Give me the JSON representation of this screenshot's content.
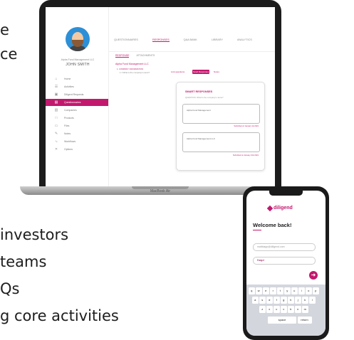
{
  "background_lines": [
    "e",
    "ce",
    "investors",
    "teams",
    "Qs",
    "g core activities"
  ],
  "laptop": {
    "brand": "MacBook Air",
    "sidebar": {
      "org_name": "Alpha Fund Management LLC",
      "user_name": "JOHN SMITH",
      "items": [
        {
          "label": "Home",
          "icon": "home-icon"
        },
        {
          "label": "Activities",
          "icon": "list-icon"
        },
        {
          "label": "Diligent Requests",
          "icon": "inbox-icon"
        },
        {
          "label": "Questionnaires",
          "icon": "document-icon"
        },
        {
          "label": "Companies",
          "icon": "building-icon"
        },
        {
          "label": "Products",
          "icon": "box-icon"
        },
        {
          "label": "Files",
          "icon": "folder-icon"
        },
        {
          "label": "Notes",
          "icon": "note-icon"
        },
        {
          "label": "Workflows",
          "icon": "flow-icon"
        },
        {
          "label": "Options",
          "icon": "settings-icon"
        }
      ]
    },
    "top_tabs": [
      "QUESTIONNAIRES",
      "RESPONSES",
      "Q&A BANK",
      "LIBRARY",
      "ANALYTICS"
    ],
    "sub_tabs": [
      "RESPONSE",
      "ATTACHMENTS"
    ],
    "fund_name": "Alpha Fund Management LLC",
    "section": "1. COMPANY INFORMATION",
    "question": "1.1 What is the company's name?",
    "btn_link": "Link questions",
    "btn_smart": "Smart Responses",
    "btn_notes": "Notes",
    "card": {
      "title": "SMART RESPONSES",
      "question": "QUESTION: What is the company's name?",
      "answers": [
        {
          "text": "Alpha Fund Management",
          "meta": "Submitted on January 1st 2021"
        },
        {
          "text": "Alpha Fund Management LLC",
          "meta": "Submitted on January 21st 2021"
        }
      ]
    }
  },
  "phone": {
    "logo": "diligend",
    "welcome": "Welcome back!",
    "email": "mattbiapp@diligend.com",
    "password": "••••••",
    "forgot": "Forgot",
    "keyboard_rows": [
      [
        "q",
        "w",
        "e",
        "r",
        "t",
        "y",
        "u",
        "i",
        "o",
        "p"
      ],
      [
        "a",
        "s",
        "d",
        "f",
        "g",
        "h",
        "j",
        "k",
        "l"
      ],
      [
        "z",
        "x",
        "c",
        "v",
        "b",
        "n",
        "m"
      ]
    ],
    "space_label": "space",
    "return_label": "return"
  }
}
